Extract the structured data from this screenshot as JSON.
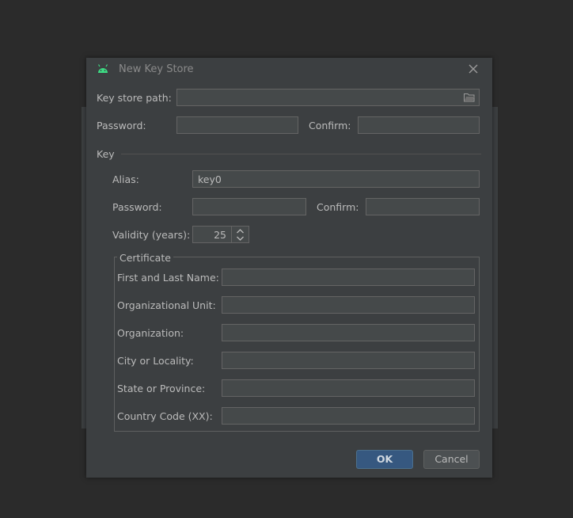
{
  "window": {
    "title": "New Key Store"
  },
  "keystore": {
    "path_label": "Key store path:",
    "path_value": "",
    "password_label": "Password:",
    "password_value": "",
    "confirm_label": "Confirm:",
    "confirm_value": ""
  },
  "key": {
    "section_label": "Key",
    "alias_label": "Alias:",
    "alias_value": "key0",
    "password_label": "Password:",
    "password_value": "",
    "confirm_label": "Confirm:",
    "confirm_value": "",
    "validity_label": "Validity (years):",
    "validity_value": "25"
  },
  "certificate": {
    "title": "Certificate",
    "first_last_name_label": "First and Last Name:",
    "org_unit_label": "Organizational Unit:",
    "organization_label": "Organization:",
    "city_label": "City or Locality:",
    "state_label": "State or Province:",
    "country_label": "Country Code (XX):"
  },
  "buttons": {
    "ok": "OK",
    "cancel": "Cancel"
  },
  "icons": {
    "app": "android-icon",
    "close": "close-icon",
    "folder": "folder-icon",
    "spin_up": "chevron-up-icon",
    "spin_down": "chevron-down-icon"
  },
  "colors": {
    "android_green": "#3ddc84",
    "primary_button": "#365880",
    "dialog_bg": "#3c3f41"
  }
}
